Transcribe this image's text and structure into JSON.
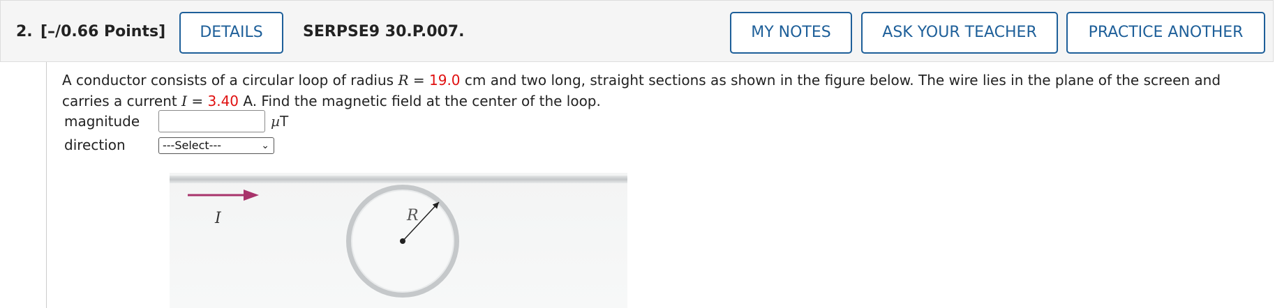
{
  "question": {
    "number": "2.",
    "points": "[–/0.66 Points]",
    "code": "SERPSE9 30.P.007."
  },
  "buttons": {
    "details": "DETAILS",
    "my_notes": "MY NOTES",
    "ask_teacher": "ASK YOUR TEACHER",
    "practice_another": "PRACTICE ANOTHER"
  },
  "prompt": {
    "part1": "A conductor consists of a circular loop of radius ",
    "var_R": "R",
    "eq1": " = ",
    "radius_value": "19.0",
    "part2": " cm and two long, straight sections as shown in the figure below. The wire lies in the plane of the screen and carries a current ",
    "var_I": "I",
    "eq2": " = ",
    "current_value": "3.40",
    "part3": " A. Find the magnetic field at the center of the loop."
  },
  "form": {
    "magnitude_label": "magnitude",
    "magnitude_value": "",
    "unit_mu": "µ",
    "unit_T": "T",
    "direction_label": "direction",
    "direction_selected": "---Select---"
  },
  "figure": {
    "current_label": "I",
    "radius_label": "R",
    "arrow_color": "#a8336b"
  },
  "colors": {
    "accent": "#1e5f99",
    "given_value": "#e01010"
  }
}
